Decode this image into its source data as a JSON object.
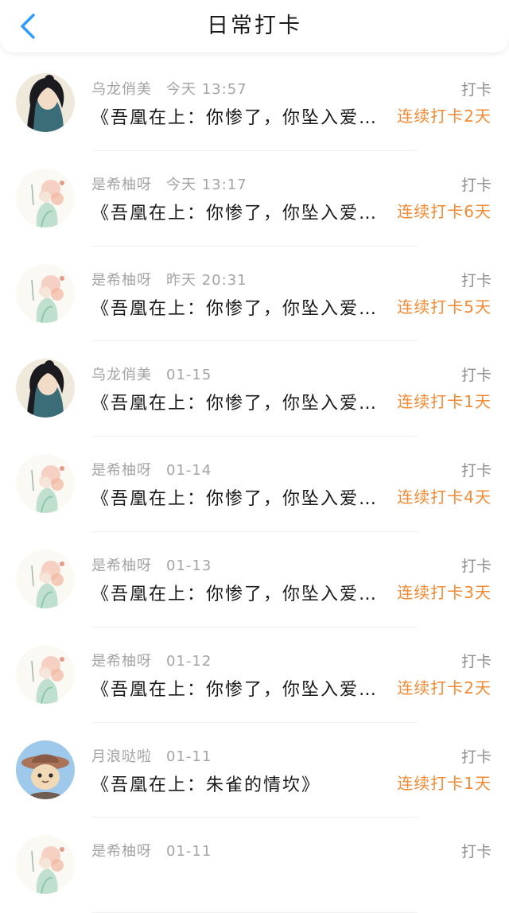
{
  "header": {
    "title": "日常打卡",
    "back_icon": "chevron-left-icon",
    "accent": "#2f9bff"
  },
  "colors": {
    "streak": "#f28a34",
    "meta": "#a4a4a4"
  },
  "rows": [
    {
      "avatar": "portrait-dark-hair",
      "user": "乌龙俏美",
      "time": "今天 13:57",
      "title": "《吾凰在上：你惨了，你坠入爱河了》",
      "tag": "打卡",
      "streak": "连续打卡2天"
    },
    {
      "avatar": "portrait-flowers",
      "user": "是希柚呀",
      "time": "今天 13:17",
      "title": "《吾凰在上：你惨了，你坠入爱河了》",
      "tag": "打卡",
      "streak": "连续打卡6天"
    },
    {
      "avatar": "portrait-flowers",
      "user": "是希柚呀",
      "time": "昨天 20:31",
      "title": "《吾凰在上：你惨了，你坠入爱河了》",
      "tag": "打卡",
      "streak": "连续打卡5天"
    },
    {
      "avatar": "portrait-dark-hair",
      "user": "乌龙俏美",
      "time": "01-15",
      "title": "《吾凰在上：你惨了，你坠入爱河了》",
      "tag": "打卡",
      "streak": "连续打卡1天"
    },
    {
      "avatar": "portrait-flowers",
      "user": "是希柚呀",
      "time": "01-14",
      "title": "《吾凰在上：你惨了，你坠入爱河了》",
      "tag": "打卡",
      "streak": "连续打卡4天"
    },
    {
      "avatar": "portrait-flowers",
      "user": "是希柚呀",
      "time": "01-13",
      "title": "《吾凰在上：你惨了，你坠入爱河了》",
      "tag": "打卡",
      "streak": "连续打卡3天"
    },
    {
      "avatar": "portrait-flowers",
      "user": "是希柚呀",
      "time": "01-12",
      "title": "《吾凰在上：你惨了，你坠入爱河了》",
      "tag": "打卡",
      "streak": "连续打卡2天"
    },
    {
      "avatar": "cartoon-cat-hat",
      "user": "月浪哒啦",
      "time": "01-11",
      "title": "《吾凰在上：朱雀的情坎》",
      "tag": "打卡",
      "streak": "连续打卡1天"
    },
    {
      "avatar": "portrait-flowers",
      "user": "是希柚呀",
      "time": "01-11",
      "title": "",
      "tag": "打卡",
      "streak": ""
    }
  ]
}
